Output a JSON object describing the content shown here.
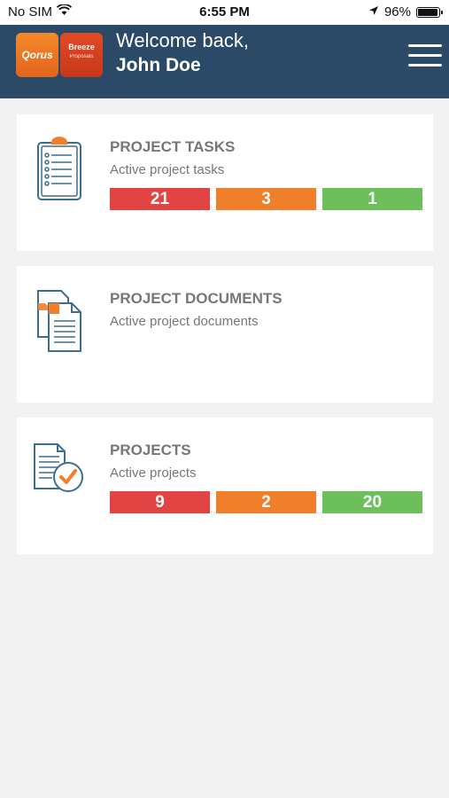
{
  "status_bar": {
    "carrier": "No SIM",
    "time": "6:55 PM",
    "battery_percent": "96%",
    "battery_level": 0.96,
    "icons": [
      "wifi-icon",
      "location-arrow-icon",
      "battery-icon"
    ]
  },
  "header": {
    "logo": {
      "left": "Qorus",
      "right": "Breeze",
      "right_sub": "Proposals"
    },
    "welcome": "Welcome back,",
    "user_name": "John Doe",
    "menu_icon": "hamburger-menu-icon"
  },
  "cards": [
    {
      "title": "PROJECT TASKS",
      "subtitle": "Active project tasks",
      "icon": "clipboard-checklist-icon",
      "counts": [
        {
          "value": "21",
          "color": "#e24444"
        },
        {
          "value": "3",
          "color": "#f07f2c"
        },
        {
          "value": "1",
          "color": "#6cbf5b"
        }
      ]
    },
    {
      "title": "PROJECT DOCUMENTS",
      "subtitle": "Active project documents",
      "icon": "documents-icon",
      "counts": []
    },
    {
      "title": "PROJECTS",
      "subtitle": "Active projects",
      "icon": "project-document-check-icon",
      "counts": [
        {
          "value": "9",
          "color": "#e24444"
        },
        {
          "value": "2",
          "color": "#f07f2c"
        },
        {
          "value": "20",
          "color": "#6cbf5b"
        }
      ]
    }
  ],
  "colors": {
    "header_bg": "#2b4a68",
    "page_bg": "#f2f2f2",
    "card_bg": "#ffffff",
    "text_gray": "#777777",
    "icon_stroke": "#3c6e8f",
    "icon_accent": "#f07f2c"
  }
}
